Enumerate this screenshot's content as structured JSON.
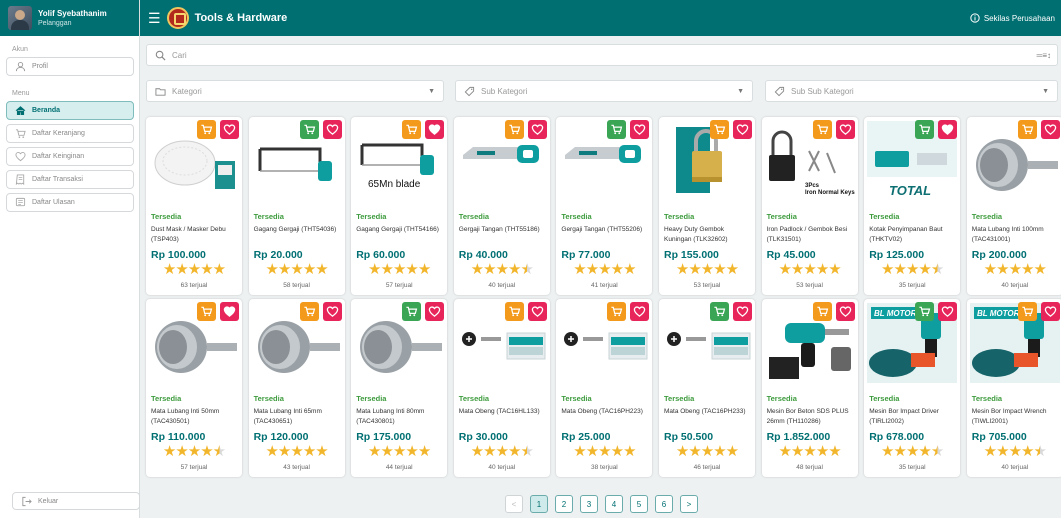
{
  "user": {
    "name": "Yolif Syebathanim",
    "role": "Pelanggan"
  },
  "sidebar": {
    "section_account": "Akun",
    "profile_label": "Profil",
    "section_menu": "Menu",
    "items": [
      {
        "label": "Beranda",
        "icon": "home-icon",
        "active": true
      },
      {
        "label": "Daftar Keranjang",
        "icon": "cart-icon",
        "active": false
      },
      {
        "label": "Daftar Keinginan",
        "icon": "heart-icon",
        "active": false
      },
      {
        "label": "Daftar Transaksi",
        "icon": "receipt-icon",
        "active": false
      },
      {
        "label": "Daftar Ulasan",
        "icon": "review-icon",
        "active": false
      }
    ],
    "logout_label": "Keluar"
  },
  "topbar": {
    "title": "Tools & Hardware",
    "company_link": "Sekilas Perusahaan"
  },
  "search": {
    "placeholder": "Cari"
  },
  "filters": {
    "category": "Kategori",
    "sub_category": "Sub Kategori",
    "sub_sub_category": "Sub Sub Kategori"
  },
  "colors": {
    "brand": "#006f72",
    "cart_orange": "#f39a1c",
    "cart_green": "#3aa655",
    "wishlist": "#e8255a",
    "star": "#f2b62d",
    "in_stock": "#3d9b3d"
  },
  "products": [
    {
      "status": "Tersedia",
      "name": "Dust Mask / Masker Debu (TSP403)",
      "price": "Rp 100.000",
      "sold": "63 terjual",
      "rating": 5,
      "cart": "orange",
      "wish_filled": false,
      "img": "mask"
    },
    {
      "status": "Tersedia",
      "name": "Gagang Gergaji (THT54036)",
      "price": "Rp 20.000",
      "sold": "58 terjual",
      "rating": 5,
      "cart": "green",
      "wish_filled": false,
      "img": "hacksaw"
    },
    {
      "status": "Tersedia",
      "name": "Gagang Gergaji (THT54166)",
      "price": "Rp 60.000",
      "sold": "57 terjual",
      "rating": 5,
      "cart": "orange",
      "wish_filled": true,
      "img": "hacksaw-blade",
      "img_text": "65Mn blade"
    },
    {
      "status": "Tersedia",
      "name": "Gergaji Tangan (THT55186)",
      "price": "Rp 40.000",
      "sold": "40 terjual",
      "rating": 4.5,
      "cart": "orange",
      "wish_filled": false,
      "img": "handsaw"
    },
    {
      "status": "Tersedia",
      "name": "Gergaji Tangan (THT55206)",
      "price": "Rp 77.000",
      "sold": "41 terjual",
      "rating": 5,
      "cart": "green",
      "wish_filled": false,
      "img": "handsaw"
    },
    {
      "status": "Tersedia",
      "name": "Heavy Duty Gembok Kuningan (TLK32602)",
      "price": "Rp 155.000",
      "sold": "53 terjual",
      "rating": 5,
      "cart": "orange",
      "wish_filled": false,
      "img": "padlock"
    },
    {
      "status": "Tersedia",
      "name": "Iron Padlock / Gembok Besi (TLK31501)",
      "price": "Rp 45.000",
      "sold": "53 terjual",
      "rating": 5,
      "cart": "orange",
      "wish_filled": false,
      "img": "iron-padlock",
      "img_text": "3Pcs Iron Normal Keys"
    },
    {
      "status": "Tersedia",
      "name": "Kotak Penyimpanan Baut (THKTV02)",
      "price": "Rp 125.000",
      "sold": "35 terjual",
      "rating": 4.5,
      "cart": "green",
      "wish_filled": true,
      "img": "storage-box",
      "img_text": "TOTAL"
    },
    {
      "status": "Tersedia",
      "name": "Mata Lubang Inti 100mm (TAC431001)",
      "price": "Rp 200.000",
      "sold": "40 terjual",
      "rating": 5,
      "cart": "orange",
      "wish_filled": false,
      "img": "core-bit"
    },
    {
      "status": "Tersedia",
      "name": "Mata Lubang Inti 50mm (TAC430501)",
      "price": "Rp 110.000",
      "sold": "57 terjual",
      "rating": 4.5,
      "cart": "orange",
      "wish_filled": true,
      "img": "core-bit"
    },
    {
      "status": "Tersedia",
      "name": "Mata Lubang Inti 65mm (TAC430651)",
      "price": "Rp 120.000",
      "sold": "43 terjual",
      "rating": 5,
      "cart": "orange",
      "wish_filled": false,
      "img": "core-bit"
    },
    {
      "status": "Tersedia",
      "name": "Mata Lubang Inti 80mm (TAC430801)",
      "price": "Rp 175.000",
      "sold": "44 terjual",
      "rating": 5,
      "cart": "green",
      "wish_filled": false,
      "img": "core-bit"
    },
    {
      "status": "Tersedia",
      "name": "Mata Obeng (TAC16HL133)",
      "price": "Rp 30.000",
      "sold": "40 terjual",
      "rating": 4.5,
      "cart": "orange",
      "wish_filled": false,
      "img": "screwdriver-bits"
    },
    {
      "status": "Tersedia",
      "name": "Mata Obeng (TAC16PH223)",
      "price": "Rp 25.000",
      "sold": "38 terjual",
      "rating": 5,
      "cart": "orange",
      "wish_filled": false,
      "img": "screwdriver-bits"
    },
    {
      "status": "Tersedia",
      "name": "Mata Obeng (TAC16PH233)",
      "price": "Rp 50.500",
      "sold": "46 terjual",
      "rating": 5,
      "cart": "green",
      "wish_filled": false,
      "img": "screwdriver-bits"
    },
    {
      "status": "Tersedia",
      "name": "Mesin Bor Beton SDS PLUS 26mm (TH110286)",
      "price": "Rp 1.852.000",
      "sold": "48 terjual",
      "rating": 5,
      "cart": "orange",
      "wish_filled": false,
      "img": "rotary-hammer"
    },
    {
      "status": "Tersedia",
      "name": "Mesin Bor Impact Driver (TIRLI2002)",
      "price": "Rp 678.000",
      "sold": "35 terjual",
      "rating": 4.5,
      "cart": "green",
      "wish_filled": false,
      "img": "impact-driver",
      "img_text": "BL MOTOR"
    },
    {
      "status": "Tersedia",
      "name": "Mesin Bor Impact Wrench (TIWLI2001)",
      "price": "Rp 705.000",
      "sold": "40 terjual",
      "rating": 4.5,
      "cart": "orange",
      "wish_filled": false,
      "img": "impact-driver",
      "img_text": "BL MOTOR"
    }
  ],
  "pagination": {
    "prev": "<",
    "pages": [
      "1",
      "2",
      "3",
      "4",
      "5",
      "6"
    ],
    "current": "1",
    "next": ">"
  }
}
